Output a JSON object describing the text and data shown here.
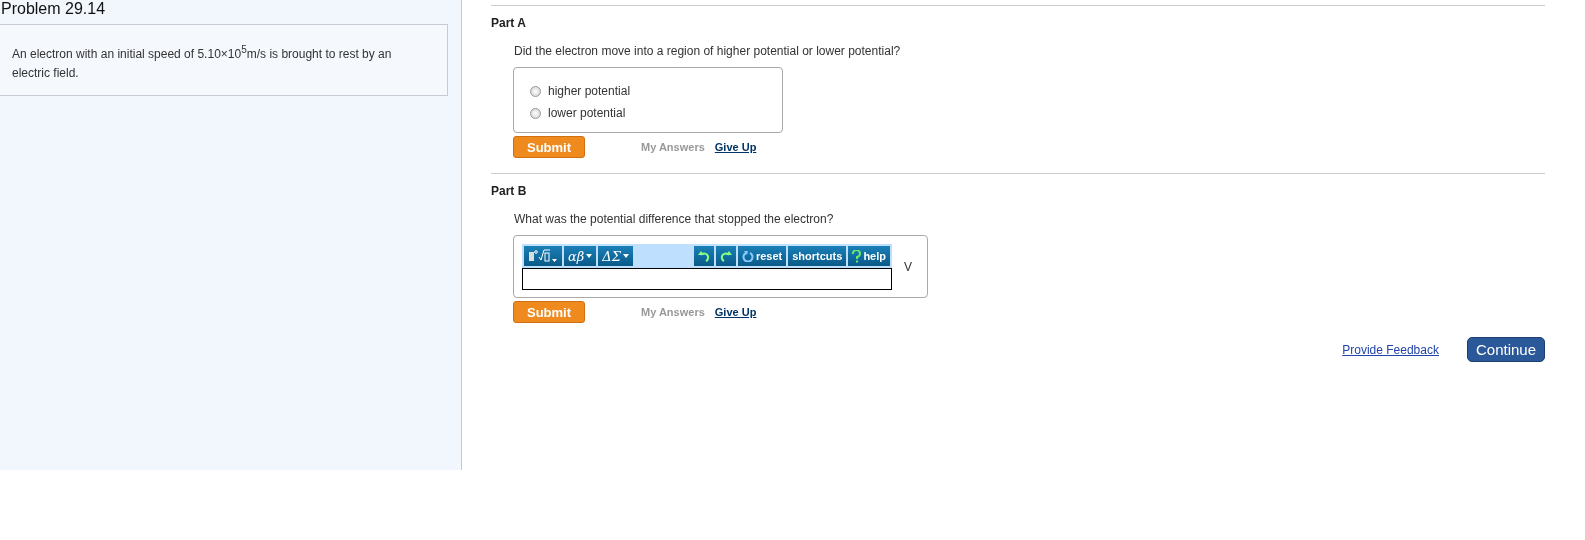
{
  "problem": {
    "title": "Problem 29.14",
    "text": "An electron with an initial speed of 5.10×10$^{5}$m/s is brought to rest by an electric field."
  },
  "parts": [
    {
      "kind": "choice",
      "title": "Part A",
      "question": "Did the electron move into a region of higher potential or lower potential?",
      "options": [
        {
          "label": "higher potential",
          "selected": false
        },
        {
          "label": "lower potential",
          "selected": false
        }
      ],
      "submit": "Submit",
      "my_answers": "My Answers",
      "give_up": "Give Up"
    },
    {
      "kind": "math",
      "title": "Part B",
      "question": "What was the potential difference that stopped the electron?",
      "toolbar": {
        "greek": "αβ",
        "ops": "ΔΣ",
        "reset": "reset",
        "shortcuts": "shortcuts",
        "help": "help"
      },
      "unit": "V",
      "submit": "Submit",
      "my_answers": "My Answers",
      "give_up": "Give Up"
    }
  ],
  "footer": {
    "feedback": "Provide Feedback",
    "continue": "Continue"
  }
}
